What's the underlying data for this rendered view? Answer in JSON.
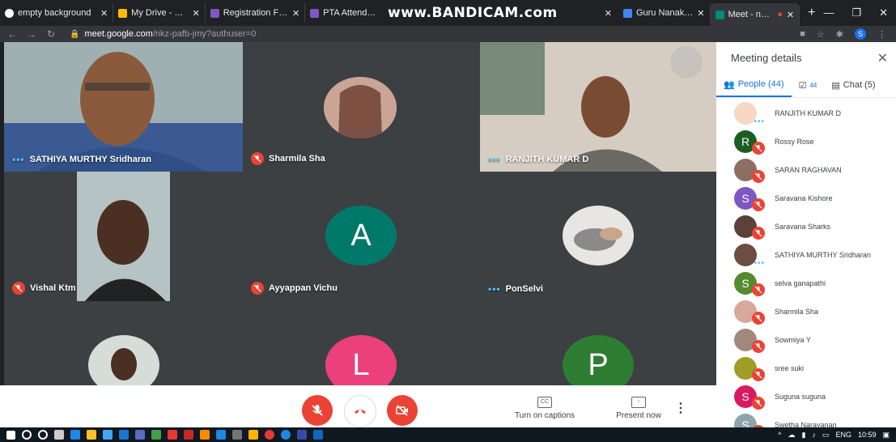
{
  "browser": {
    "tabs": [
      {
        "title": "empty background",
        "favicon_color": "#ffffff"
      },
      {
        "title": "My Drive - Google",
        "favicon_color": "#fbbc04"
      },
      {
        "title": "Registration Form",
        "favicon_color": "#7e57c2"
      },
      {
        "title": "PTA Attendance F",
        "favicon_color": "#7e57c2"
      },
      {
        "title": "Guru Nanak Colle",
        "favicon_color": "#4285f4"
      },
      {
        "title": "Meet - nkz-pa",
        "favicon_color": "#00897b"
      }
    ],
    "watermark": "www.BANDICAM.com",
    "url_domain": "meet.google.com",
    "url_path": "/nkz-pafb-jmy?authuser=0",
    "profile_initial": "S"
  },
  "tiles": [
    {
      "name": "SATHIYA MURTHY Sridharan",
      "status": "speaking"
    },
    {
      "name": "Sharmila Sha",
      "status": "muted"
    },
    {
      "name": "RANJITH KUMAR D",
      "status": "speaking"
    },
    {
      "name": "Vishal Ktm",
      "status": "muted"
    },
    {
      "name": "Ayyappan Vichu",
      "status": "muted",
      "initial": "A",
      "color": "#00796b"
    },
    {
      "name": "PonSelvi",
      "status": "speaking"
    },
    {
      "name": "",
      "status": "none"
    },
    {
      "name": "",
      "status": "none",
      "initial": "L",
      "color": "#ec407a"
    },
    {
      "name": "",
      "status": "none",
      "initial": "P",
      "color": "#2e7d32"
    }
  ],
  "controls": {
    "captions_label": "Turn on captions",
    "captions_icon_text": "CC",
    "present_label": "Present now"
  },
  "panel": {
    "title": "Meeting details",
    "people_tab": "People (44)",
    "checklist_count": "44",
    "chat_tab": "Chat (5)",
    "people": [
      {
        "name": "RANJITH KUMAR D",
        "status": "speaking",
        "avatar_color": "#f8d7c4"
      },
      {
        "name": "Rossy Rose",
        "status": "muted",
        "initial": "R",
        "avatar_color": "#1b5e20"
      },
      {
        "name": "SARAN RAGHAVAN",
        "status": "muted",
        "avatar_color": "#8d6e63"
      },
      {
        "name": "Saravana Kishore",
        "status": "muted",
        "initial": "S",
        "avatar_color": "#7e57c2"
      },
      {
        "name": "Saravana Sharks",
        "status": "muted",
        "avatar_color": "#5d4037"
      },
      {
        "name": "SATHIYA MURTHY Sridharan",
        "status": "speaking",
        "avatar_color": "#6d4c41"
      },
      {
        "name": "selva ganapathi",
        "status": "muted",
        "initial": "S",
        "avatar_color": "#558b2f"
      },
      {
        "name": "Sharmila Sha",
        "status": "muted",
        "avatar_color": "#d7a99a"
      },
      {
        "name": "Sowmiya Y",
        "status": "muted",
        "avatar_color": "#a1887f"
      },
      {
        "name": "sree suki",
        "status": "muted",
        "avatar_color": "#9e9d24"
      },
      {
        "name": "Suguna suguna",
        "status": "muted",
        "initial": "S",
        "avatar_color": "#d81b60"
      },
      {
        "name": "Swetha Narayanan",
        "status": "muted",
        "initial": "S",
        "avatar_color": "#90a4ae"
      }
    ]
  },
  "taskbar": {
    "language": "ENG",
    "time": "10:59"
  }
}
